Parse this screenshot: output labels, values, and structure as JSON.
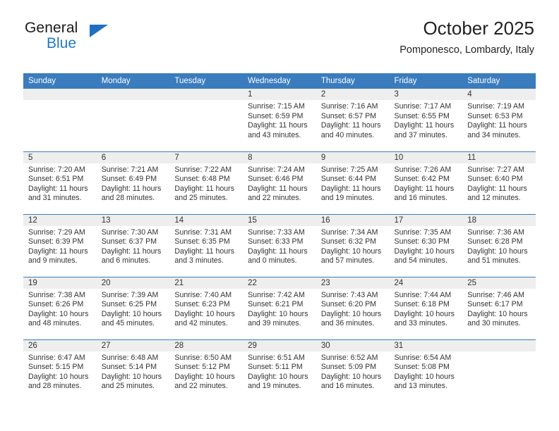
{
  "brand": {
    "word_one": "General",
    "word_two": "Blue",
    "triangle_icon": "triangle-icon",
    "accent_color": "#1f78c8"
  },
  "header": {
    "title": "October 2025",
    "subtitle": "Pomponesco, Lombardy, Italy"
  },
  "theme": {
    "header_row_bg": "#3a7cbe",
    "daynum_band_bg": "#eeeeee",
    "text_color": "#333333"
  },
  "weekday_headers": [
    "Sunday",
    "Monday",
    "Tuesday",
    "Wednesday",
    "Thursday",
    "Friday",
    "Saturday"
  ],
  "labels": {
    "sunrise_prefix": "Sunrise:",
    "sunset_prefix": "Sunset:",
    "daylight_prefix": "Daylight:"
  },
  "weeks": [
    [
      {
        "day": "",
        "empty": true
      },
      {
        "day": "",
        "empty": true
      },
      {
        "day": "",
        "empty": true
      },
      {
        "day": "1",
        "sunrise": "Sunrise: 7:15 AM",
        "sunset": "Sunset: 6:59 PM",
        "daylight": "Daylight: 11 hours and 43 minutes."
      },
      {
        "day": "2",
        "sunrise": "Sunrise: 7:16 AM",
        "sunset": "Sunset: 6:57 PM",
        "daylight": "Daylight: 11 hours and 40 minutes."
      },
      {
        "day": "3",
        "sunrise": "Sunrise: 7:17 AM",
        "sunset": "Sunset: 6:55 PM",
        "daylight": "Daylight: 11 hours and 37 minutes."
      },
      {
        "day": "4",
        "sunrise": "Sunrise: 7:19 AM",
        "sunset": "Sunset: 6:53 PM",
        "daylight": "Daylight: 11 hours and 34 minutes."
      }
    ],
    [
      {
        "day": "5",
        "sunrise": "Sunrise: 7:20 AM",
        "sunset": "Sunset: 6:51 PM",
        "daylight": "Daylight: 11 hours and 31 minutes."
      },
      {
        "day": "6",
        "sunrise": "Sunrise: 7:21 AM",
        "sunset": "Sunset: 6:49 PM",
        "daylight": "Daylight: 11 hours and 28 minutes."
      },
      {
        "day": "7",
        "sunrise": "Sunrise: 7:22 AM",
        "sunset": "Sunset: 6:48 PM",
        "daylight": "Daylight: 11 hours and 25 minutes."
      },
      {
        "day": "8",
        "sunrise": "Sunrise: 7:24 AM",
        "sunset": "Sunset: 6:46 PM",
        "daylight": "Daylight: 11 hours and 22 minutes."
      },
      {
        "day": "9",
        "sunrise": "Sunrise: 7:25 AM",
        "sunset": "Sunset: 6:44 PM",
        "daylight": "Daylight: 11 hours and 19 minutes."
      },
      {
        "day": "10",
        "sunrise": "Sunrise: 7:26 AM",
        "sunset": "Sunset: 6:42 PM",
        "daylight": "Daylight: 11 hours and 16 minutes."
      },
      {
        "day": "11",
        "sunrise": "Sunrise: 7:27 AM",
        "sunset": "Sunset: 6:40 PM",
        "daylight": "Daylight: 11 hours and 12 minutes."
      }
    ],
    [
      {
        "day": "12",
        "sunrise": "Sunrise: 7:29 AM",
        "sunset": "Sunset: 6:39 PM",
        "daylight": "Daylight: 11 hours and 9 minutes."
      },
      {
        "day": "13",
        "sunrise": "Sunrise: 7:30 AM",
        "sunset": "Sunset: 6:37 PM",
        "daylight": "Daylight: 11 hours and 6 minutes."
      },
      {
        "day": "14",
        "sunrise": "Sunrise: 7:31 AM",
        "sunset": "Sunset: 6:35 PM",
        "daylight": "Daylight: 11 hours and 3 minutes."
      },
      {
        "day": "15",
        "sunrise": "Sunrise: 7:33 AM",
        "sunset": "Sunset: 6:33 PM",
        "daylight": "Daylight: 11 hours and 0 minutes."
      },
      {
        "day": "16",
        "sunrise": "Sunrise: 7:34 AM",
        "sunset": "Sunset: 6:32 PM",
        "daylight": "Daylight: 10 hours and 57 minutes."
      },
      {
        "day": "17",
        "sunrise": "Sunrise: 7:35 AM",
        "sunset": "Sunset: 6:30 PM",
        "daylight": "Daylight: 10 hours and 54 minutes."
      },
      {
        "day": "18",
        "sunrise": "Sunrise: 7:36 AM",
        "sunset": "Sunset: 6:28 PM",
        "daylight": "Daylight: 10 hours and 51 minutes."
      }
    ],
    [
      {
        "day": "19",
        "sunrise": "Sunrise: 7:38 AM",
        "sunset": "Sunset: 6:26 PM",
        "daylight": "Daylight: 10 hours and 48 minutes."
      },
      {
        "day": "20",
        "sunrise": "Sunrise: 7:39 AM",
        "sunset": "Sunset: 6:25 PM",
        "daylight": "Daylight: 10 hours and 45 minutes."
      },
      {
        "day": "21",
        "sunrise": "Sunrise: 7:40 AM",
        "sunset": "Sunset: 6:23 PM",
        "daylight": "Daylight: 10 hours and 42 minutes."
      },
      {
        "day": "22",
        "sunrise": "Sunrise: 7:42 AM",
        "sunset": "Sunset: 6:21 PM",
        "daylight": "Daylight: 10 hours and 39 minutes."
      },
      {
        "day": "23",
        "sunrise": "Sunrise: 7:43 AM",
        "sunset": "Sunset: 6:20 PM",
        "daylight": "Daylight: 10 hours and 36 minutes."
      },
      {
        "day": "24",
        "sunrise": "Sunrise: 7:44 AM",
        "sunset": "Sunset: 6:18 PM",
        "daylight": "Daylight: 10 hours and 33 minutes."
      },
      {
        "day": "25",
        "sunrise": "Sunrise: 7:46 AM",
        "sunset": "Sunset: 6:17 PM",
        "daylight": "Daylight: 10 hours and 30 minutes."
      }
    ],
    [
      {
        "day": "26",
        "sunrise": "Sunrise: 6:47 AM",
        "sunset": "Sunset: 5:15 PM",
        "daylight": "Daylight: 10 hours and 28 minutes."
      },
      {
        "day": "27",
        "sunrise": "Sunrise: 6:48 AM",
        "sunset": "Sunset: 5:14 PM",
        "daylight": "Daylight: 10 hours and 25 minutes."
      },
      {
        "day": "28",
        "sunrise": "Sunrise: 6:50 AM",
        "sunset": "Sunset: 5:12 PM",
        "daylight": "Daylight: 10 hours and 22 minutes."
      },
      {
        "day": "29",
        "sunrise": "Sunrise: 6:51 AM",
        "sunset": "Sunset: 5:11 PM",
        "daylight": "Daylight: 10 hours and 19 minutes."
      },
      {
        "day": "30",
        "sunrise": "Sunrise: 6:52 AM",
        "sunset": "Sunset: 5:09 PM",
        "daylight": "Daylight: 10 hours and 16 minutes."
      },
      {
        "day": "31",
        "sunrise": "Sunrise: 6:54 AM",
        "sunset": "Sunset: 5:08 PM",
        "daylight": "Daylight: 10 hours and 13 minutes."
      },
      {
        "day": "",
        "empty": true
      }
    ]
  ]
}
